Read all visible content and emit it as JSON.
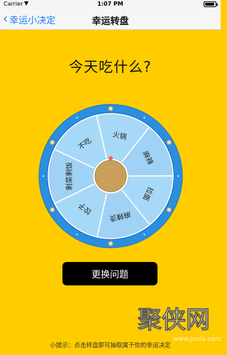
{
  "status_bar": {
    "carrier": "Carrier",
    "time": "1:07 PM"
  },
  "nav": {
    "back_label": "幸运小决定",
    "title": "幸运转盘"
  },
  "question": "今天吃什么?",
  "wheel": {
    "options": [
      "火锅",
      "麻辣",
      "拉面",
      "麻辣烫",
      "饺子",
      "剩菜剩饭",
      "不吃"
    ],
    "colors": {
      "ring": "#2a8fe0",
      "slice": "#a8d8f7",
      "divider": "#ffffff",
      "hub": "#c9a15c"
    }
  },
  "buttons": {
    "change_question": "更换问题"
  },
  "tip": "小提示：点击转盘即可抽取属于你的幸运决定",
  "watermark": {
    "text": "聚侠网",
    "url": "www.juxia.com"
  }
}
